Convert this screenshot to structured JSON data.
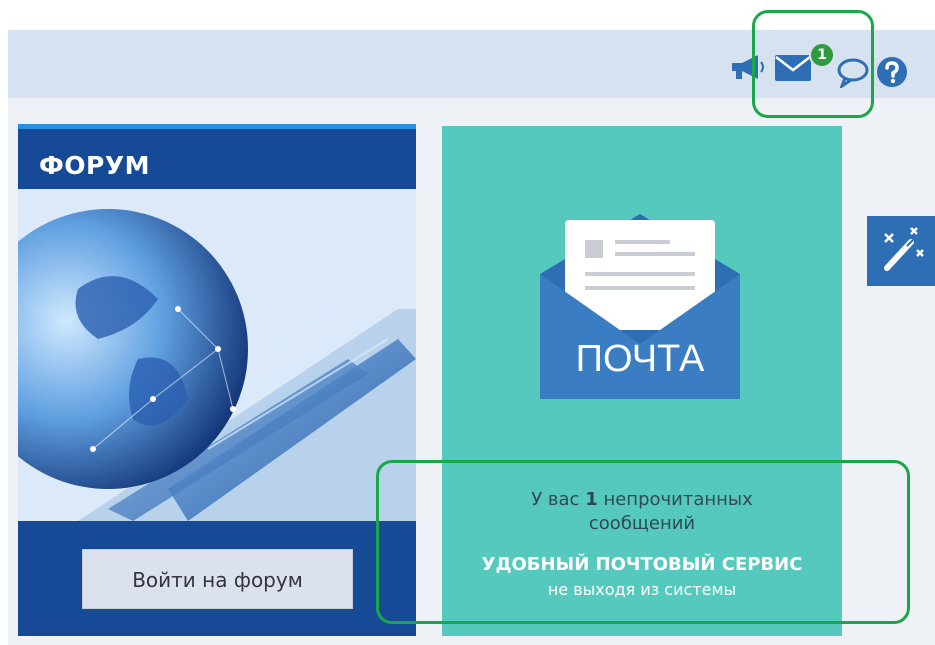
{
  "header": {
    "icons": [
      "megaphone-icon",
      "mail-icon",
      "chat-icon",
      "help-icon"
    ],
    "mail_badge": "1"
  },
  "forum": {
    "title": "ФОРУМ",
    "button_label": "Войти на форум"
  },
  "mail": {
    "word": "ПОЧТА",
    "unread_prefix": "У вас",
    "unread_count": "1",
    "unread_suffix": "непрочитанных",
    "unread_line2": "сообщений",
    "service_title": "УДОБНЫЙ ПОЧТОВЫЙ СЕРВИС",
    "service_subtitle": "не выходя из системы"
  },
  "side": {
    "tool_icon": "magic-wand-icon"
  },
  "colors": {
    "header_bg": "#d6e2f0",
    "icon_blue": "#2d6eb4",
    "badge_green": "#2f9a3f",
    "highlight_green": "#18a84a",
    "forum_blue": "#174a96",
    "mail_teal": "#56c9bf"
  }
}
